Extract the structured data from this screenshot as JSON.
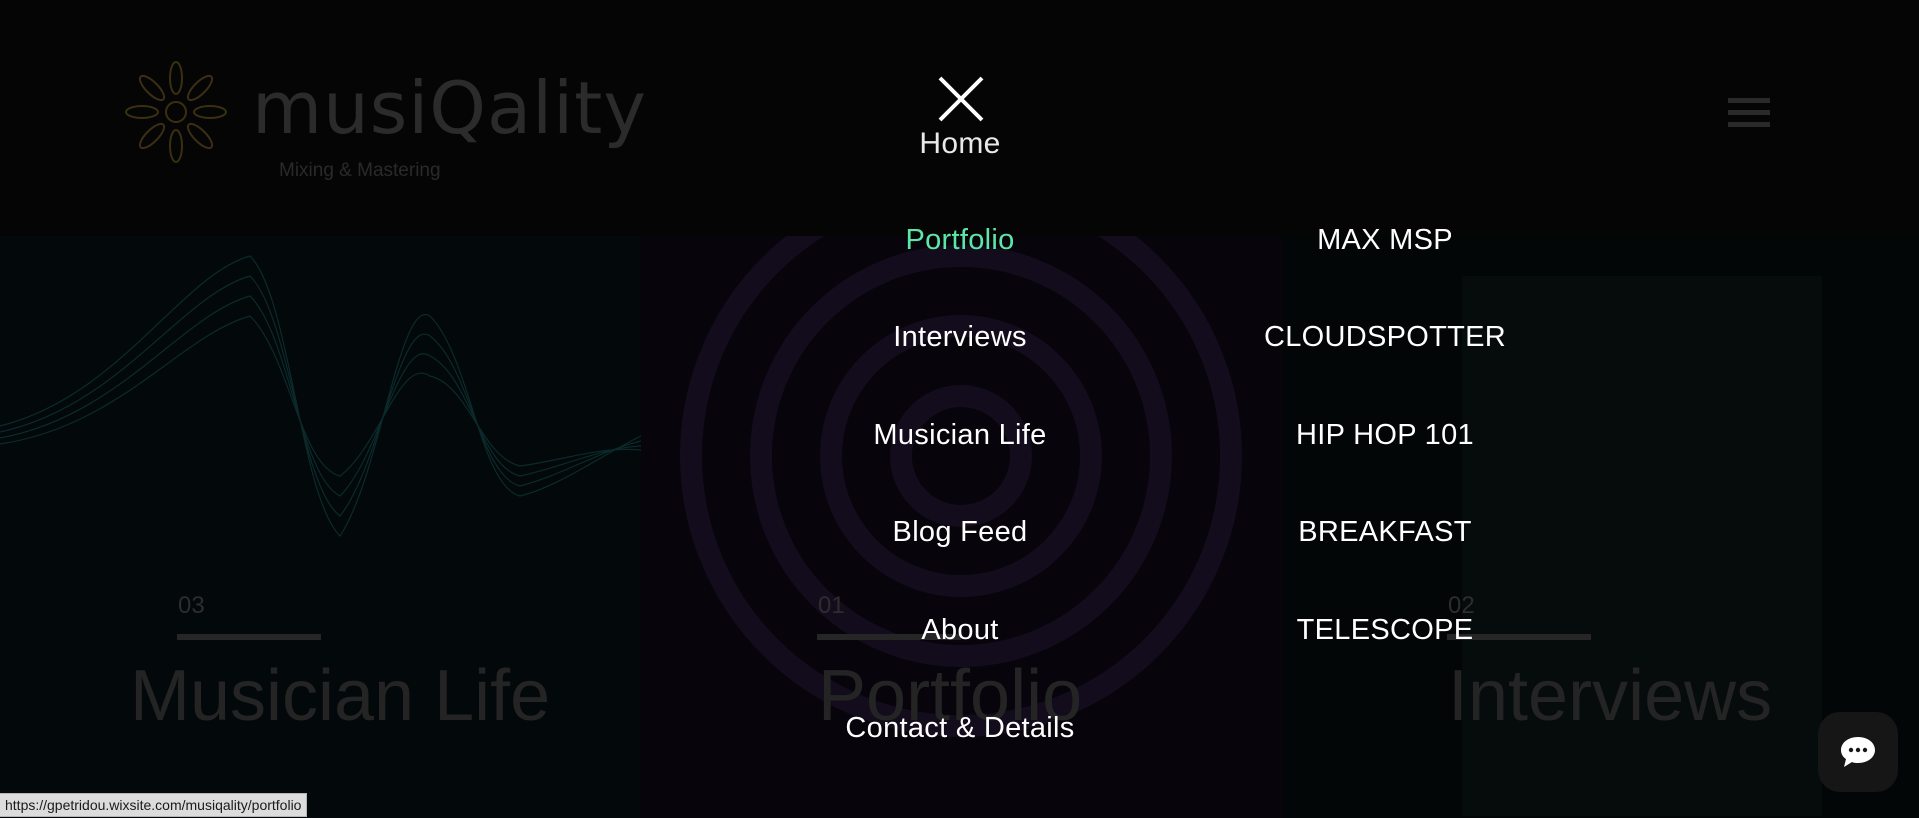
{
  "site": {
    "brand": "musiQality",
    "tagline": "Mixing & Mastering"
  },
  "background_panels": [
    {
      "number": "03",
      "title": "Musician Life"
    },
    {
      "number": "01",
      "title": "Portfolio"
    },
    {
      "number": "02",
      "title": "Interviews"
    }
  ],
  "menu": {
    "home": "Home",
    "left_items": [
      {
        "label": "Portfolio",
        "active": true
      },
      {
        "label": "Interviews",
        "active": false
      },
      {
        "label": "Musician Life",
        "active": false
      },
      {
        "label": "Blog Feed",
        "active": false
      },
      {
        "label": "About",
        "active": false
      },
      {
        "label": "Contact & Details",
        "active": false
      }
    ],
    "right_items": [
      {
        "label": "MAX MSP"
      },
      {
        "label": "CLOUDSPOTTER"
      },
      {
        "label": "HIP HOP 101"
      },
      {
        "label": "BREAKFAST"
      },
      {
        "label": "TELESCOPE"
      }
    ]
  },
  "status_bar": {
    "url": "https://gpetridou.wixsite.com/musiqality/portfolio"
  },
  "colors": {
    "active": "#5ce6a8",
    "text": "#ffffff",
    "background": "#000000"
  },
  "icons": {
    "close": "close-icon",
    "menu": "hamburger-icon",
    "chat": "chat-icon",
    "logo": "mandala-logo-icon"
  }
}
